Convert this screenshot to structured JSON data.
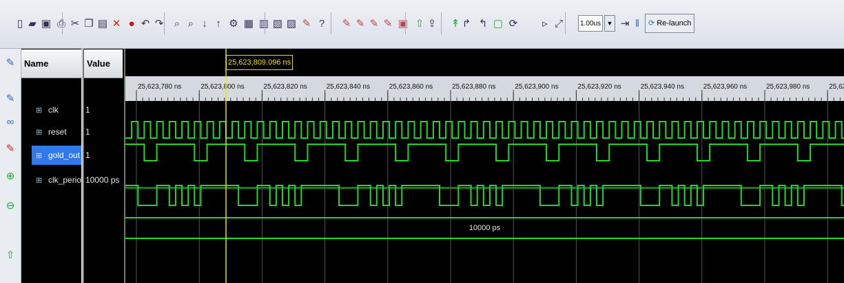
{
  "toolbar": {
    "time_value": "1.00us",
    "relaunch_label": "Re-launch",
    "icons": [
      "new-file-icon",
      "open-folder-icon",
      "save-icon",
      "print-icon",
      "cut-icon",
      "copy-icon",
      "paste-icon",
      "delete-icon",
      "stop-icon",
      "undo-icon",
      "redo-icon",
      "find-icon",
      "find-next-icon",
      "sort-down-icon",
      "sort-up-icon",
      "settings-icon",
      "zoom-fit-icon",
      "zoom-in-icon",
      "zoom-out-icon",
      "zoom-full-icon",
      "marker-icon",
      "help-icon",
      "marker-a-icon",
      "marker-b-icon",
      "marker-c-icon",
      "marker-d-icon",
      "marker-e-icon",
      "step-icon",
      "go-to-time-icon",
      "run-icon",
      "pause-icon",
      "restart-icon",
      "run-to-icon",
      "relaunch-icon"
    ]
  },
  "left_strip": {
    "icons": [
      "marker-pin-icon",
      "marker-pin-icon",
      "link-icon",
      "marker-pin-red-icon",
      "zoom-plus-icon",
      "zoom-minus-icon",
      "run-icon"
    ]
  },
  "headers": {
    "name": "Name",
    "value": "Value"
  },
  "signals": [
    {
      "name": "clk",
      "value": "1",
      "type": "clock"
    },
    {
      "name": "reset",
      "value": "1",
      "type": "pulse"
    },
    {
      "name": "gold_out",
      "value": "1",
      "type": "data",
      "selected": true
    },
    {
      "name": "clk_perio",
      "value": "10000 ps",
      "type": "bus"
    }
  ],
  "cursor": {
    "label": "25,623,809.096 ns"
  },
  "timeline": {
    "ticks": [
      "25,623,780 ns",
      "25,623,800 ns",
      "25,623,820 ns",
      "25,623,840 ns",
      "25,623,860 ns",
      "25,623,880 ns",
      "25,623,900 ns",
      "25,623,920 ns",
      "25,623,940 ns",
      "25,623,960 ns",
      "25,623,980 ns",
      "25,62"
    ],
    "bus_value": "10000 ps"
  },
  "colors": {
    "wave": "#22d82a",
    "cursor": "#f0e000",
    "selection": "#3079ed"
  }
}
